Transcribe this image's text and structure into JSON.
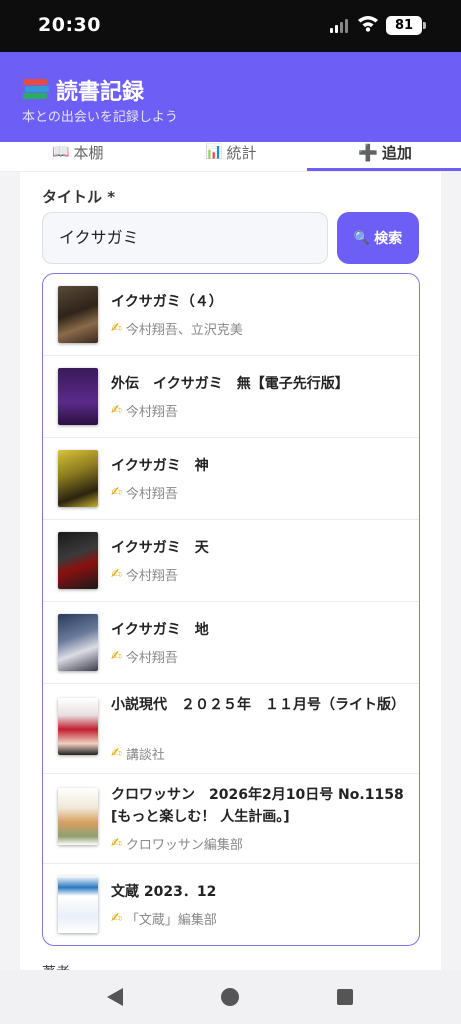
{
  "status": {
    "time": "20:30",
    "battery": "81"
  },
  "header": {
    "title": "読書記録",
    "subtitle": "本との出会いを記録しよう",
    "icon": "books-icon"
  },
  "tabs": [
    {
      "label": "本棚",
      "icon": "book-icon"
    },
    {
      "label": "統計",
      "icon": "chart-icon"
    },
    {
      "label": "追加",
      "icon": "plus-icon",
      "active": true
    }
  ],
  "form": {
    "title_label": "タイトル *",
    "title_value": "イクサガミ",
    "search_label": "検索",
    "next_label_peek": "著者"
  },
  "results": [
    {
      "title": "イクサガミ（４）",
      "author": "今村翔吾、立沢克美"
    },
    {
      "title": "外伝　イクサガミ　無【電子先行版】",
      "author": "今村翔吾"
    },
    {
      "title": "イクサガミ　神",
      "author": "今村翔吾"
    },
    {
      "title": "イクサガミ　天",
      "author": "今村翔吾"
    },
    {
      "title": "イクサガミ　地",
      "author": "今村翔吾"
    },
    {
      "title": "小説現代　２０２５年　１１月号（ライト版）",
      "author": "講談社"
    },
    {
      "title": "クロワッサン　2026年2月10日号 No.1158 [もっと楽しむ！ 人生計画。]",
      "author": "クロワッサン編集部"
    },
    {
      "title": "文蔵 2023．12",
      "author": "「文蔵」編集部"
    }
  ],
  "colors": {
    "accent": "#6d5ff5",
    "results_border": "#8176e8"
  }
}
